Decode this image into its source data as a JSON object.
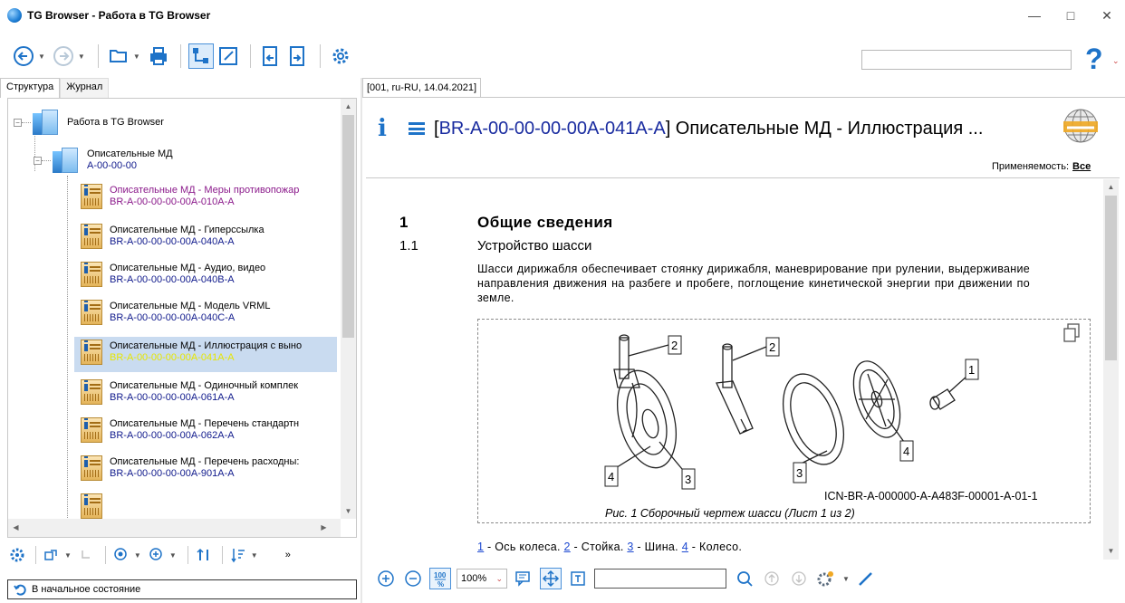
{
  "window": {
    "title": "TG Browser - Работа в TG Browser",
    "controls": [
      "—",
      "□",
      "✕"
    ]
  },
  "toolbar": {
    "search_value": "",
    "help_label": "?"
  },
  "left_panel": {
    "tabs": [
      {
        "label": "Структура",
        "active": true
      },
      {
        "label": "Журнал",
        "active": false
      }
    ],
    "tree": {
      "root": {
        "label": "Работа в TG Browser"
      },
      "folder": {
        "label": "Описательные МД",
        "code": "A-00-00-00"
      },
      "items": [
        {
          "label": "Описательные МД - Меры противопожар",
          "code": "BR-A-00-00-00-00A-010A-A",
          "visited": true
        },
        {
          "label": "Описательные МД - Гиперссылка",
          "code": "BR-A-00-00-00-00A-040A-A"
        },
        {
          "label": "Описательные МД - Аудио, видео",
          "code": "BR-A-00-00-00-00A-040B-A"
        },
        {
          "label": "Описательные МД - Модель VRML",
          "code": "BR-A-00-00-00-00A-040C-A"
        },
        {
          "label": "Описательные МД - Иллюстрация с выно",
          "code": "BR-A-00-00-00-00A-041A-A",
          "selected": true
        },
        {
          "label": "Описательные МД - Одиночный комплек",
          "code": "BR-A-00-00-00-00A-061A-A"
        },
        {
          "label": "Описательные МД - Перечень стандартн",
          "code": "BR-A-00-00-00-00A-062A-A"
        },
        {
          "label": "Описательные МД - Перечень расходны:",
          "code": "BR-A-00-00-00-00A-901A-A"
        }
      ]
    },
    "status": "В начальное состояние"
  },
  "document": {
    "tab_label": "[001, ru-RU, 14.04.2021]",
    "title_prefix": "[",
    "title_code": "BR-A-00-00-00-00A-041A-A",
    "title_rest": "] Описательные МД - Иллюстрация ...",
    "applicability_label": "Применяемость:",
    "applicability_value": "Все",
    "section1_num": "1",
    "section1_title": "Общие сведения",
    "section11_num": "1.1",
    "section11_title": "Устройство шасси",
    "paragraph": "Шасси дирижабля обеспечивает стоянку дирижабля, маневрирование при рулении, выдерживание направления движения на разбеге и пробеге, поглощение кинетической энергии при движении по земле.",
    "figure": {
      "icn": "ICN-BR-A-000000-A-A483F-00001-A-01-1",
      "caption": "Рис. 1  Сборочный чертеж шасси (Лист 1 из 2)",
      "callouts": [
        "1",
        "2",
        "3",
        "4"
      ]
    },
    "legend": [
      {
        "num": "1",
        "text": " - Ось колеса. "
      },
      {
        "num": "2",
        "text": " - Стойка. "
      },
      {
        "num": "3",
        "text": " - Шина. "
      },
      {
        "num": "4",
        "text": " - Колесо."
      }
    ]
  },
  "bottom_toolbar": {
    "zoom_value": "100%",
    "find_value": ""
  },
  "colors": {
    "accent": "#1e73c8",
    "selection": "#c9dbf0",
    "code_text": "#101a8c",
    "visited_text": "#8b1a8b",
    "selected_code": "#e6e600"
  }
}
